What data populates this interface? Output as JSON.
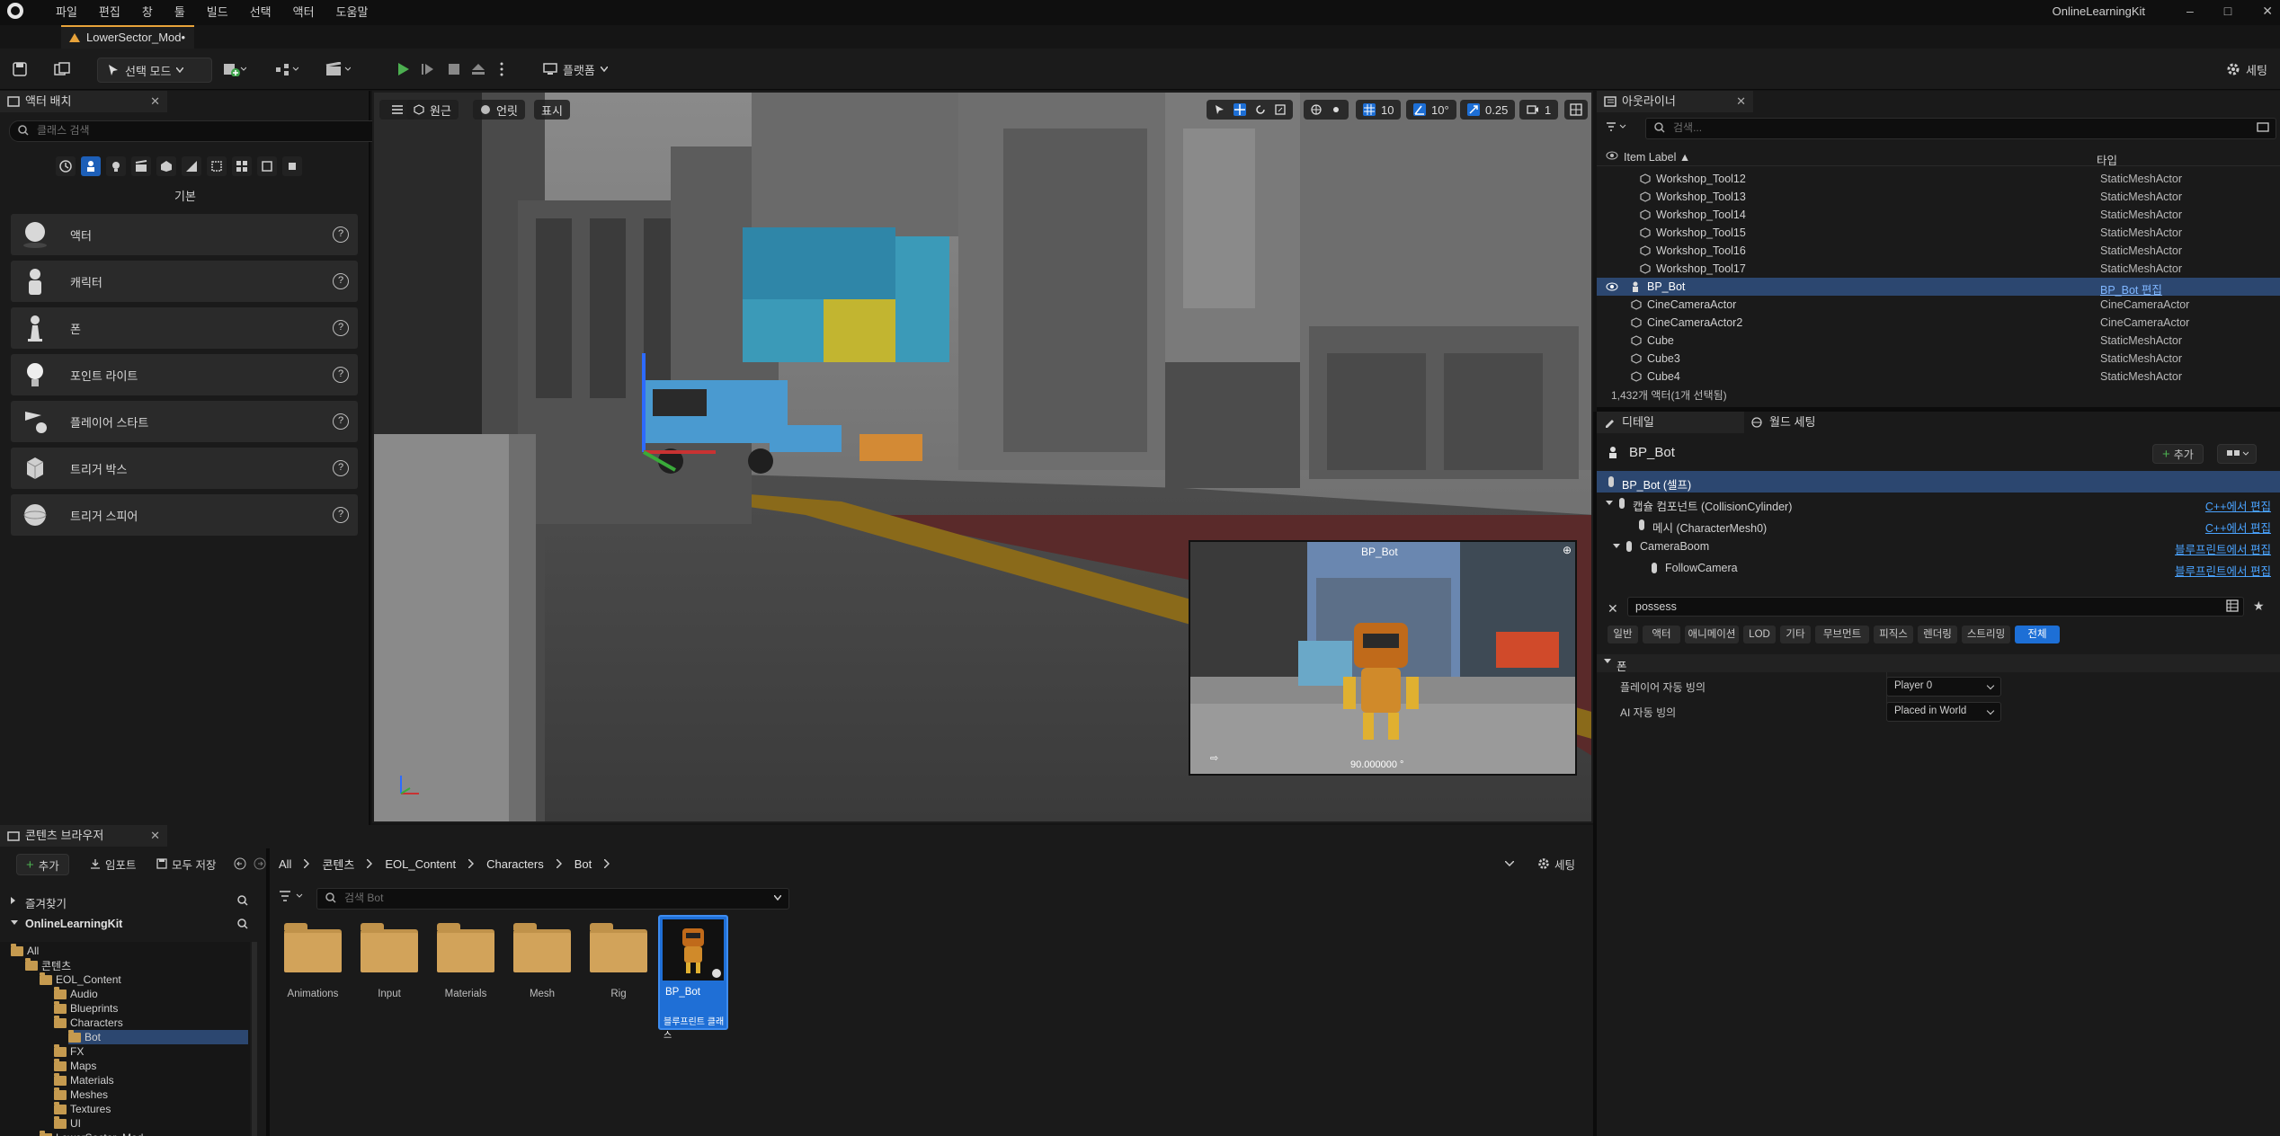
{
  "menu": {
    "items": [
      "파일",
      "편집",
      "창",
      "툴",
      "빌드",
      "선택",
      "액터",
      "도움말"
    ]
  },
  "project_name": "OnlineLearningKit",
  "window_controls": [
    "–",
    "□",
    "✕"
  ],
  "doc_tab": {
    "label": "LowerSector_Mod•"
  },
  "toolbar": {
    "mode_label": "선택 모드",
    "platform_label": "플랫폼",
    "settings_label": "세팅"
  },
  "place_actors": {
    "tab_label": "액터 배치",
    "search_placeholder": "클래스 검색",
    "section_label": "기본",
    "items": [
      {
        "label": "액터"
      },
      {
        "label": "캐릭터"
      },
      {
        "label": "폰"
      },
      {
        "label": "포인트 라이트"
      },
      {
        "label": "플레이어 스타트"
      },
      {
        "label": "트리거 박스"
      },
      {
        "label": "트리거 스피어"
      }
    ]
  },
  "viewport": {
    "perspective_label": "원근",
    "lit_label": "언릿",
    "show_label": "표시",
    "grid_snap": "10",
    "rotation_snap": "10°",
    "scale_snap": "0.25",
    "camera_speed": "1",
    "pip_title": "BP_Bot",
    "pip_fov": "90.000000 °"
  },
  "outliner": {
    "tab_label": "아웃라이너",
    "search_placeholder": "검색...",
    "col_label": "Item Label ▲",
    "col_type": "타입",
    "rows": [
      {
        "name": "Workshop_Tool12",
        "type": "StaticMeshActor"
      },
      {
        "name": "Workshop_Tool13",
        "type": "StaticMeshActor"
      },
      {
        "name": "Workshop_Tool14",
        "type": "StaticMeshActor"
      },
      {
        "name": "Workshop_Tool15",
        "type": "StaticMeshActor"
      },
      {
        "name": "Workshop_Tool16",
        "type": "StaticMeshActor"
      },
      {
        "name": "Workshop_Tool17",
        "type": "StaticMeshActor"
      },
      {
        "name": "BP_Bot",
        "type": "BP_Bot 편집"
      },
      {
        "name": "CineCameraActor",
        "type": "CineCameraActor"
      },
      {
        "name": "CineCameraActor2",
        "type": "CineCameraActor"
      },
      {
        "name": "Cube",
        "type": "StaticMeshActor"
      },
      {
        "name": "Cube3",
        "type": "StaticMeshActor"
      },
      {
        "name": "Cube4",
        "type": "StaticMeshActor"
      }
    ],
    "count_text": "1,432개 액터(1개 선택됨)"
  },
  "details": {
    "tab_label": "디테일",
    "world_settings_label": "월드 세팅",
    "actor_name": "BP_Bot",
    "add_label": "추가",
    "components": [
      {
        "label": "BP_Bot (셀프)",
        "link": ""
      },
      {
        "label": "캡슐 컴포넌트 (CollisionCylinder)",
        "link": "C++에서 편집"
      },
      {
        "label": "메시 (CharacterMesh0)",
        "link": "C++에서 편집"
      },
      {
        "label": "CameraBoom",
        "link": "블루프린트에서 편집"
      },
      {
        "label": "FollowCamera",
        "link": "블루프린트에서 편집"
      }
    ],
    "search_value": "possess",
    "category_tabs": [
      "일반",
      "액터",
      "애니메이션",
      "LOD",
      "기타",
      "무브먼트",
      "피직스",
      "렌더링",
      "스트리밍",
      "전체"
    ],
    "section_label": "폰",
    "properties": [
      {
        "label": "플레이어 자동 빙의",
        "value": "Player 0"
      },
      {
        "label": "AI 자동 빙의",
        "value": "Placed in World"
      }
    ]
  },
  "content_browser": {
    "tab_label": "콘텐츠 브라우저",
    "add_label": "추가",
    "import_label": "임포트",
    "save_all_label": "모두 저장",
    "settings_label": "세팅",
    "breadcrumb": [
      "All",
      "콘텐츠",
      "EOL_Content",
      "Characters",
      "Bot"
    ],
    "favorites_label": "즐겨찾기",
    "project_label": "OnlineLearningKit",
    "search_placeholder": "검색 Bot",
    "tree": [
      {
        "label": "All",
        "indent": 0
      },
      {
        "label": "콘텐츠",
        "indent": 1
      },
      {
        "label": "EOL_Content",
        "indent": 2
      },
      {
        "label": "Audio",
        "indent": 3
      },
      {
        "label": "Blueprints",
        "indent": 3
      },
      {
        "label": "Characters",
        "indent": 3
      },
      {
        "label": "Bot",
        "indent": 4
      },
      {
        "label": "FX",
        "indent": 3
      },
      {
        "label": "Maps",
        "indent": 3
      },
      {
        "label": "Materials",
        "indent": 3
      },
      {
        "label": "Meshes",
        "indent": 3
      },
      {
        "label": "Textures",
        "indent": 3
      },
      {
        "label": "UI",
        "indent": 3
      },
      {
        "label": "LowerSector_Mod",
        "indent": 2
      }
    ],
    "assets": [
      {
        "label": "Animations"
      },
      {
        "label": "Input"
      },
      {
        "label": "Materials"
      },
      {
        "label": "Mesh"
      },
      {
        "label": "Rig"
      }
    ],
    "selected_asset": {
      "label": "BP_Bot",
      "sublabel": "블루프린트 클래스"
    }
  },
  "colors": {
    "accent": "#1d6fd6",
    "selection": "#2c4770",
    "link": "#4aa3ff",
    "play": "#4caf50",
    "folder": "#c0924a"
  }
}
